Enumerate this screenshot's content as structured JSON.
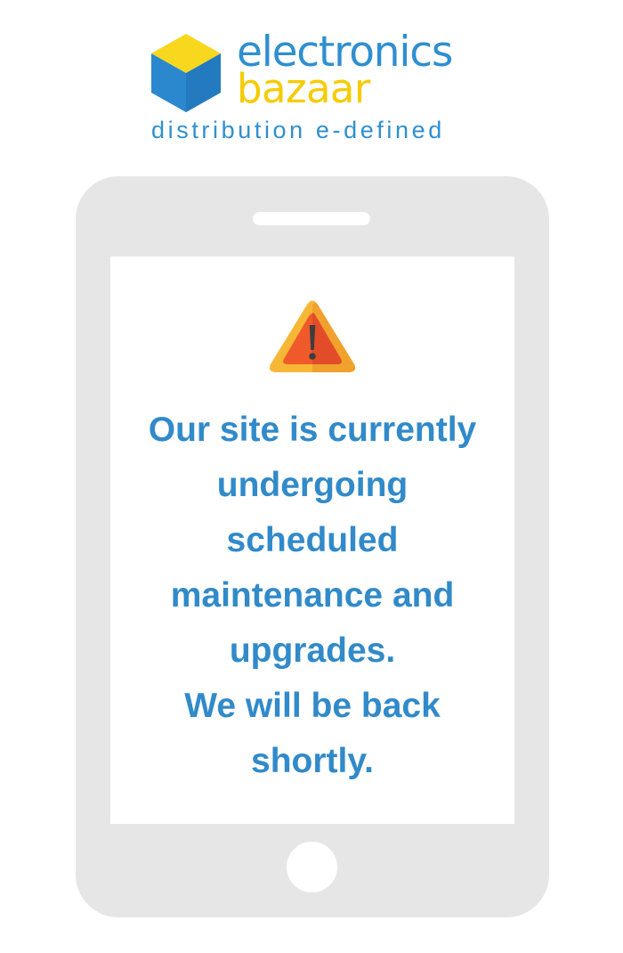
{
  "brand": {
    "word1": "electronics",
    "word2": "bazaar",
    "tagline": "distribution e-defined",
    "colors": {
      "blue": "#2f8fcf",
      "yellow": "#f5cc00"
    },
    "icon": "cube-logo-icon"
  },
  "notice": {
    "icon": "warning-icon",
    "lines": [
      "Our site is currently",
      "undergoing",
      "scheduled",
      "maintenance and",
      "upgrades.",
      "We will be back",
      "shortly."
    ],
    "color": "#318ac9"
  },
  "device": {
    "frame_color": "#e6e6e6"
  }
}
